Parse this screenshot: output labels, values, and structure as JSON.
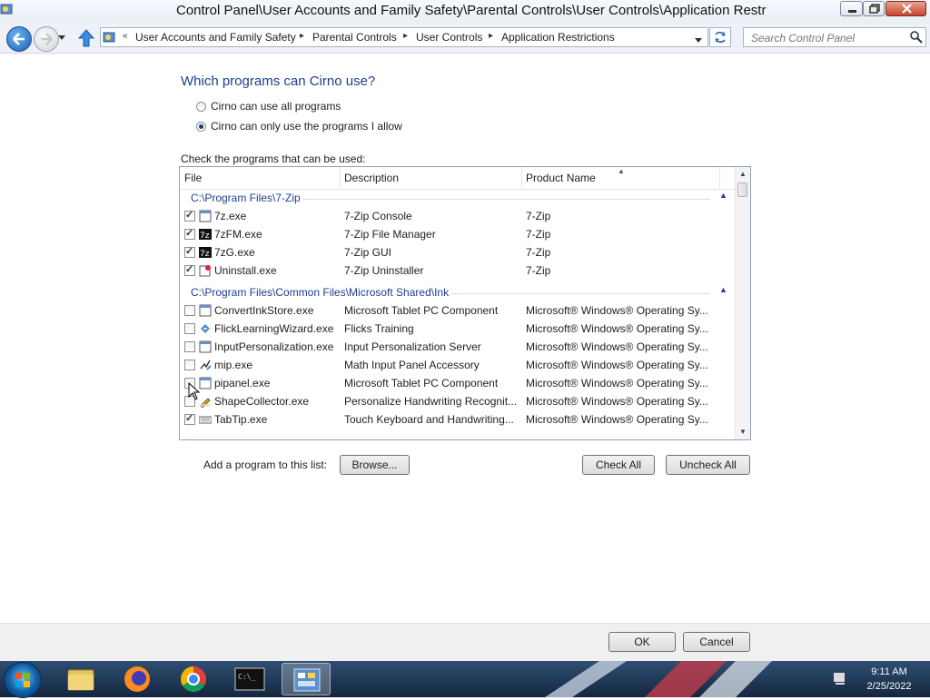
{
  "window": {
    "title": "Control Panel\\User Accounts and Family Safety\\Parental Controls\\User Controls\\Application Restr"
  },
  "address_bar": {
    "crumbs": [
      "User Accounts and Family Safety",
      "Parental Controls",
      "User Controls",
      "Application Restrictions"
    ]
  },
  "search": {
    "placeholder": "Search Control Panel"
  },
  "page": {
    "heading": "Which programs can Cirno use?",
    "radio_all": "Cirno can use all programs",
    "radio_allow": "Cirno can only use the programs I allow",
    "selected_radio": "radio_allow",
    "check_prompt": "Check the programs that can be used:"
  },
  "columns": {
    "file": "File",
    "description": "Description",
    "product": "Product Name"
  },
  "groups": [
    {
      "path": "C:\\Program Files\\7-Zip",
      "rows": [
        {
          "checked": true,
          "icon": "console-exe-icon",
          "file": "7z.exe",
          "description": "7-Zip Console",
          "product": "7-Zip"
        },
        {
          "checked": true,
          "icon": "7zip-app-icon",
          "file": "7zFM.exe",
          "description": "7-Zip File Manager",
          "product": "7-Zip"
        },
        {
          "checked": true,
          "icon": "7zip-app-icon",
          "file": "7zG.exe",
          "description": "7-Zip GUI",
          "product": "7-Zip"
        },
        {
          "checked": true,
          "icon": "uninstall-icon",
          "file": "Uninstall.exe",
          "description": "7-Zip Uninstaller",
          "product": "7-Zip"
        }
      ]
    },
    {
      "path": "C:\\Program Files\\Common Files\\Microsoft Shared\\Ink",
      "rows": [
        {
          "checked": false,
          "icon": "console-exe-icon",
          "file": "ConvertInkStore.exe",
          "description": "Microsoft Tablet PC Component",
          "product": "Microsoft® Windows® Operating Sy..."
        },
        {
          "checked": false,
          "icon": "flicks-icon",
          "file": "FlickLearningWizard.exe",
          "description": "Flicks Training",
          "product": "Microsoft® Windows® Operating Sy..."
        },
        {
          "checked": false,
          "icon": "console-exe-icon",
          "file": "InputPersonalization.exe",
          "description": "Input Personalization Server",
          "product": "Microsoft® Windows® Operating Sy..."
        },
        {
          "checked": false,
          "icon": "math-input-icon",
          "file": "mip.exe",
          "description": "Math Input Panel Accessory",
          "product": "Microsoft® Windows® Operating Sy..."
        },
        {
          "checked": false,
          "icon": "console-exe-icon",
          "file": "pipanel.exe",
          "description": "Microsoft Tablet PC Component",
          "product": "Microsoft® Windows® Operating Sy..."
        },
        {
          "checked": false,
          "icon": "pen-icon",
          "file": "ShapeCollector.exe",
          "description": "Personalize Handwriting Recognit...",
          "product": "Microsoft® Windows® Operating Sy..."
        },
        {
          "checked": true,
          "icon": "keyboard-icon",
          "file": "TabTip.exe",
          "description": "Touch Keyboard and Handwriting...",
          "product": "Microsoft® Windows® Operating Sy..."
        }
      ]
    }
  ],
  "actions": {
    "add_label": "Add a program to this list:",
    "browse": "Browse...",
    "check_all": "Check All",
    "uncheck_all": "Uncheck All",
    "ok": "OK",
    "cancel": "Cancel"
  },
  "taskbar": {
    "time": "9:11 AM",
    "date": "2/25/2022",
    "accent": "#1c3a5e"
  }
}
